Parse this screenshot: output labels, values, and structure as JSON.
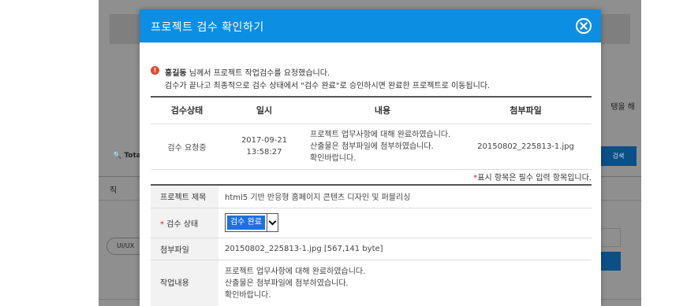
{
  "background": {
    "right_text": "탱을 해",
    "search_label": "Tota",
    "search_button": "검색",
    "column_label": "직",
    "pill_text": "UI/UX",
    "right_box_text": "종"
  },
  "modal": {
    "title": "프로젝트 검수 확인하기",
    "close_icon": "close-circle-icon",
    "notice": {
      "requester": "홍길동",
      "line1_rest": " 님께서 프로젝트 작업검수를 요청했습니다.",
      "line2": "검수가 끝나고 최종적으로 검수 상태에서 \"검수 완료\"로 승인하시면 완료한 프로젝트로 이동됩니다."
    },
    "status_table": {
      "headers": [
        "검수상태",
        "일시",
        "내용",
        "첨부파일"
      ],
      "row": {
        "status": "검수 요청중",
        "date": "2017-09-21",
        "time": "13:58:27",
        "content_lines": [
          "프로젝트 업무사항에 대해 완료하였습니다.",
          "산출물은 첨부파일에 첨부하였습니다.",
          "확인바랍니다."
        ],
        "attachment": "20150802_225813-1.jpg"
      }
    },
    "required_note": {
      "star": "*",
      "text": "표시 항목은 필수 입력 항목입니다."
    },
    "form": {
      "project_title_label": "프로젝트 제목",
      "project_title_value": "html5 기반 반응형 홈페이지 콘텐츠 디자인 및 퍼블리싱",
      "review_status_star": "*",
      "review_status_label": " 검수 상태",
      "review_status_selected": "검수 완료",
      "attachment_label": "첨부파일",
      "attachment_value": "20150802_225813-1.jpg [567,141 byte]",
      "work_content_label": "작업내용",
      "work_content_lines": [
        "프로젝트 업무사항에 대해 완료하였습니다.",
        "산출물은 첨부파일에 첨부하였습니다.",
        "확인바랍니다."
      ]
    }
  },
  "colors": {
    "header_blue": "#0c8ee3",
    "required_red": "#e0201f",
    "info_icon_red": "#e24a2b",
    "selected_blue": "#1f6fe0"
  }
}
